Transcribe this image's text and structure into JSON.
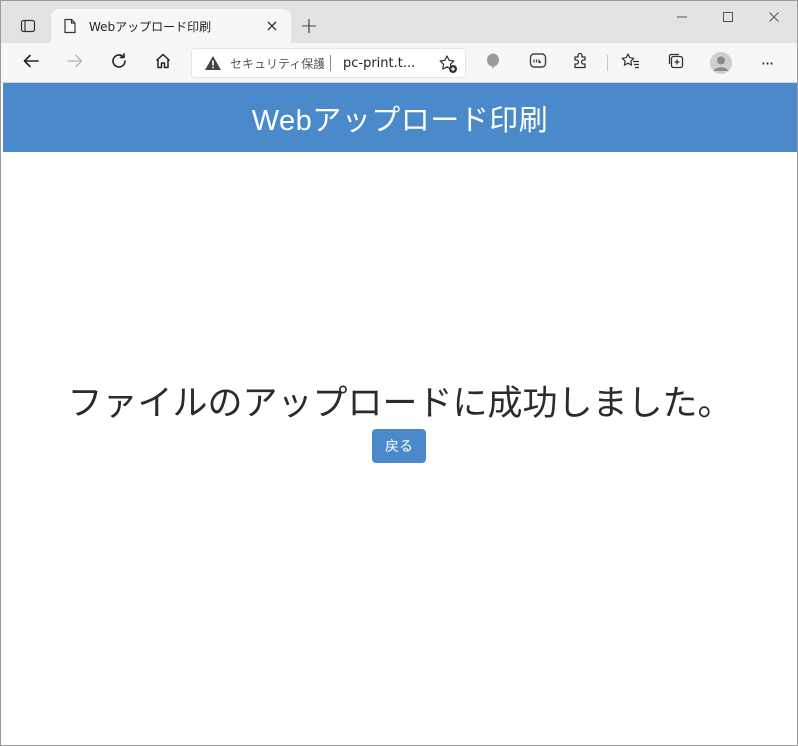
{
  "browser": {
    "tab": {
      "title": "Webアップロード印刷",
      "close_glyph": "×",
      "favicon": "page-icon"
    },
    "new_tab_glyph": "+",
    "window_controls": [
      "minimize-icon",
      "maximize-icon",
      "close-icon"
    ],
    "toolbar": {
      "buttons": [
        "back-icon",
        "forward-icon",
        "refresh-icon",
        "home-icon"
      ],
      "extensions": [
        "balloon-icon",
        "line-icon",
        "extensions-icon",
        "favorites-icon",
        "collections-icon",
        "profile-icon",
        "more-icon"
      ],
      "more_glyph": "···"
    },
    "address_bar": {
      "security_text": "セキュリティ保護な",
      "url": "pc-print.t..."
    }
  },
  "page": {
    "header_title": "Webアップロード印刷",
    "message": "ファイルのアップロードに成功しました。",
    "back_button_label": "戻る"
  },
  "colors": {
    "accent": "#4a8acb",
    "tabstrip": "#e3e3e3",
    "toolbar": "#f7f7f7"
  }
}
